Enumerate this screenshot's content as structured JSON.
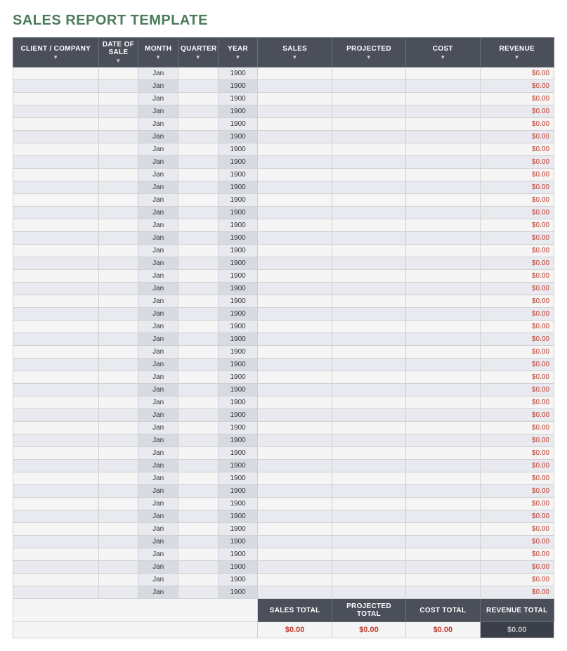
{
  "title": "SALES REPORT TEMPLATE",
  "columns": {
    "client": "CLIENT / COMPANY",
    "date_of_sale": "DATE OF SALE",
    "month": "MONTH",
    "quarter": "QUARTER",
    "year": "YEAR",
    "sales": "SALES",
    "projected": "PROJECTED",
    "cost": "COST",
    "revenue": "REVENUE"
  },
  "default_month": "Jan",
  "default_year": "1900",
  "default_revenue": "$0.00",
  "row_count": 42,
  "footer": {
    "labels": {
      "sales_total": "SALES TOTAL",
      "projected_total": "PROJECTED TOTAL",
      "cost_total": "COST TOTAL",
      "revenue_total": "REVENUE TOTAL"
    },
    "values": {
      "sales_total": "$0.00",
      "projected_total": "$0.00",
      "cost_total": "$0.00",
      "revenue_total": "$0.00"
    }
  }
}
